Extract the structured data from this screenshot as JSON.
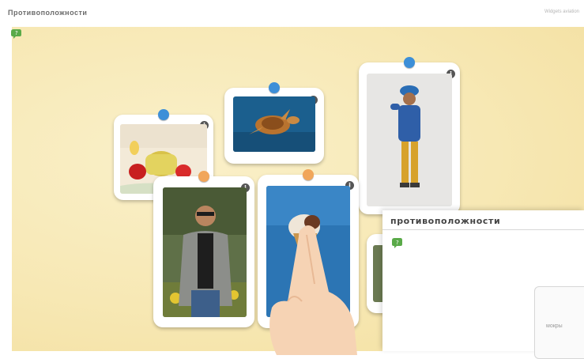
{
  "header": {
    "title": "Противоположности",
    "credit": "Widgets aviation"
  },
  "cards": [
    {
      "id": "tea",
      "pin": "blue"
    },
    {
      "id": "turtle",
      "pin": "blue"
    },
    {
      "id": "boy",
      "pin": "blue"
    },
    {
      "id": "man",
      "pin": "orange"
    },
    {
      "id": "icecream",
      "pin": "orange"
    },
    {
      "id": "partial",
      "pin": "none"
    }
  ],
  "info_glyph": "i",
  "popup": {
    "title": "противоположности",
    "card_text": "мокры"
  },
  "icons": [
    "help-icon",
    "info-icon",
    "pin-icon",
    "hand-pointer-icon"
  ],
  "colors": {
    "board": "#f7e8b4",
    "pin_blue": "#3d8fd8",
    "pin_orange": "#f1a65a"
  }
}
